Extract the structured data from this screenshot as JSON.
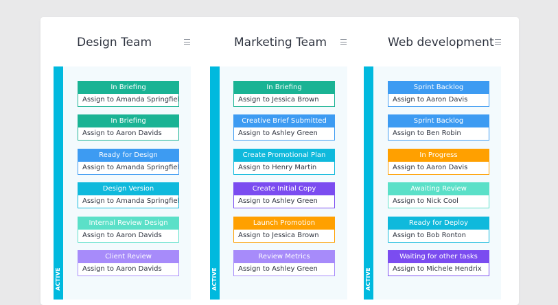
{
  "columns": [
    {
      "title": "Design Team",
      "status": "ACTIVE",
      "cards": [
        {
          "status": "In Briefing",
          "assignee": "Assign to Amanda Springfield",
          "color": "#1ab394"
        },
        {
          "status": "In Briefing",
          "assignee": "Assign to Aaron Davids",
          "color": "#1ab394"
        },
        {
          "status": "Ready for Design",
          "assignee": "Assign to Amanda Springfield",
          "color": "#3d9bf2"
        },
        {
          "status": "Design Version",
          "assignee": "Assign to Amanda Springfield",
          "color": "#0fb9dc"
        },
        {
          "status": "Internal Review Design",
          "assignee": "Assign to Aaron Davids",
          "color": "#5be0c8"
        },
        {
          "status": "Client Review",
          "assignee": "Assign to Aaron Davids",
          "color": "#a78bfa"
        }
      ]
    },
    {
      "title": "Marketing Team",
      "status": "ACTIVE",
      "cards": [
        {
          "status": "In Briefing",
          "assignee": "Assign to Jessica Brown",
          "color": "#1ab394"
        },
        {
          "status": "Creative Brief Submitted",
          "assignee": "Assign to Ashley Green",
          "color": "#3d9bf2"
        },
        {
          "status": "Create Promotional Plan",
          "assignee": "Assign to Henry Martin",
          "color": "#0fb9dc"
        },
        {
          "status": "Create Initial Copy",
          "assignee": "Assign to Ashley Green",
          "color": "#7b4cf0"
        },
        {
          "status": "Launch Promotion",
          "assignee": "Assign to Jessica Brown",
          "color": "#ffa000"
        },
        {
          "status": "Review Metrics",
          "assignee": "Assign to Ashley Green",
          "color": "#a78bfa"
        }
      ]
    },
    {
      "title": "Web development",
      "status": "ACTIVE",
      "cards": [
        {
          "status": "Sprint Backlog",
          "assignee": "Assign to Aaron Davis",
          "color": "#3d9bf2"
        },
        {
          "status": "Sprint Backlog",
          "assignee": "Assign to Ben Robin",
          "color": "#3d9bf2"
        },
        {
          "status": "In Progress",
          "assignee": "Assign to Aaron Davis",
          "color": "#ffa000"
        },
        {
          "status": "Awaiting Review",
          "assignee": "Assign to Nick Cool",
          "color": "#5be0c8"
        },
        {
          "status": "Ready for Deploy",
          "assignee": "Assign to Bob Ronton",
          "color": "#0fb9dc"
        },
        {
          "status": "Waiting for other tasks",
          "assignee": "Assign to Michele Hendrix",
          "color": "#7b4cf0"
        }
      ]
    }
  ],
  "accent_color": "#00b9de"
}
